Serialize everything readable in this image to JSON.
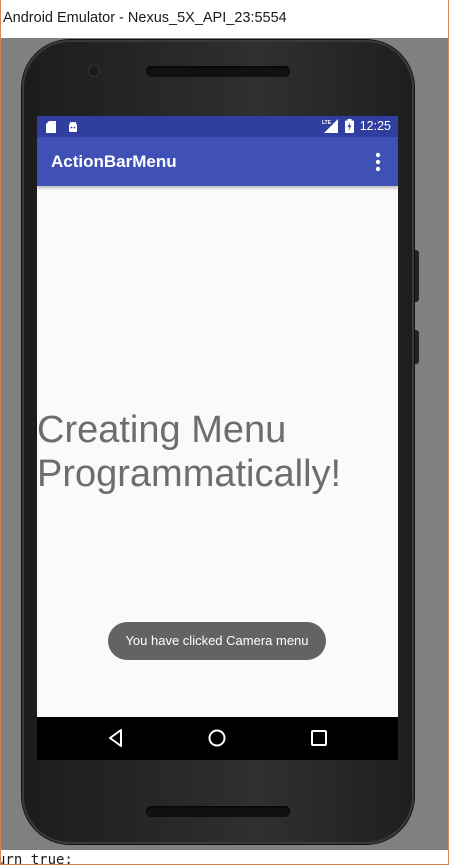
{
  "window": {
    "title": "Android Emulator - Nexus_5X_API_23:5554"
  },
  "status_bar": {
    "time": "12:25",
    "left_icons": [
      "sd-card-icon",
      "android-debug-icon"
    ],
    "right_icons": [
      "lte-signal-icon",
      "battery-charging-icon"
    ],
    "color": "#303f9f"
  },
  "action_bar": {
    "title": "ActionBarMenu",
    "overflow_icon": "more-vert-icon",
    "color": "#3f51b5"
  },
  "content": {
    "message": "Creating Menu\nProgrammatically!"
  },
  "toast": {
    "text": "You have clicked Camera menu"
  },
  "nav_bar": {
    "buttons": [
      "back-icon",
      "home-icon",
      "recents-icon"
    ]
  },
  "background_code": {
    "text": "urn true;"
  }
}
